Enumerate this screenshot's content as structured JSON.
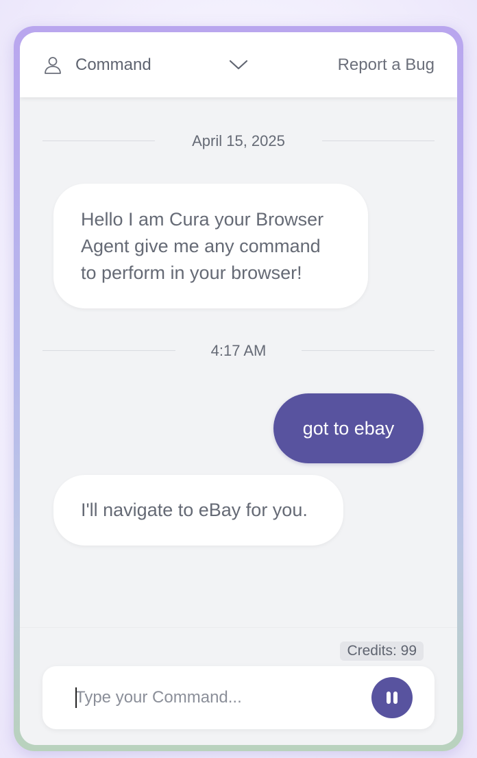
{
  "header": {
    "mode_label": "Command",
    "report_bug_label": "Report a Bug"
  },
  "chat": {
    "date_divider": "April 15, 2025",
    "time_divider": "4:17 AM",
    "messages": [
      {
        "sender": "agent",
        "text": "Hello I am Cura your Browser Agent give me any command to perform in your browser!"
      },
      {
        "sender": "user",
        "text": "got to ebay"
      },
      {
        "sender": "agent",
        "text": "I'll navigate to eBay for you."
      }
    ]
  },
  "footer": {
    "credits": "Credits: 99",
    "input_placeholder": "Type your Command...",
    "input_value": ""
  },
  "icons": {
    "mode": "user-icon",
    "dropdown": "chevron-down-icon",
    "action": "pause-icon"
  },
  "colors": {
    "accent": "#58539f",
    "panel_bg": "#f2f3f5",
    "text": "#656a75"
  }
}
